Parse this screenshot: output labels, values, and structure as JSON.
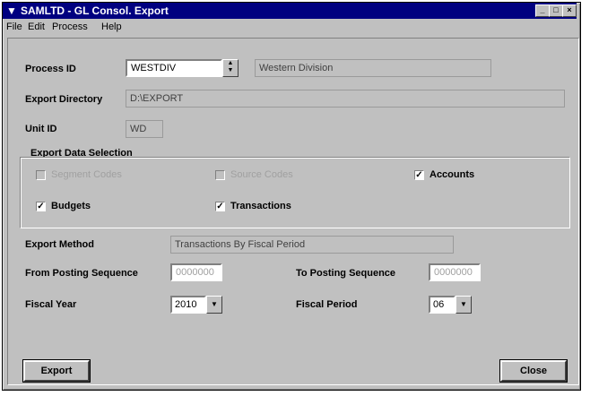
{
  "window": {
    "title": "SAMLTD - GL Consol. Export",
    "app_icon": "app-icon"
  },
  "menu": [
    "File",
    "Edit",
    "Process",
    "Help"
  ],
  "form": {
    "process_id_label": "Process ID",
    "process_id_value": "WESTDIV",
    "process_desc": "Western Division",
    "export_dir_label": "Export Directory",
    "export_dir_value": "D:\\EXPORT",
    "unit_id_label": "Unit ID",
    "unit_id_value": "WD",
    "selection_title": "Export Data Selection",
    "checks": [
      {
        "label": "Segment Codes",
        "checked": false,
        "enabled": false
      },
      {
        "label": "Source Codes",
        "checked": false,
        "enabled": false
      },
      {
        "label": "Accounts",
        "checked": true,
        "enabled": true
      },
      {
        "label": "Budgets",
        "checked": true,
        "enabled": true
      },
      {
        "label": "Transactions",
        "checked": true,
        "enabled": true
      }
    ],
    "check_mark": "✓",
    "export_method_label": "Export Method",
    "export_method_value": "Transactions By Fiscal Period",
    "from_seq_label": "From Posting Sequence",
    "from_seq_value": "0000000",
    "to_seq_label": "To Posting Sequence",
    "to_seq_value": "0000000",
    "fiscal_year_label": "Fiscal Year",
    "fiscal_year_value": "2010",
    "fiscal_period_label": "Fiscal Period",
    "fiscal_period_value": "06"
  },
  "buttons": {
    "export": "Export",
    "close": "Close"
  },
  "colors": {
    "titlebar": "#000080",
    "face": "#c0c0c0"
  }
}
